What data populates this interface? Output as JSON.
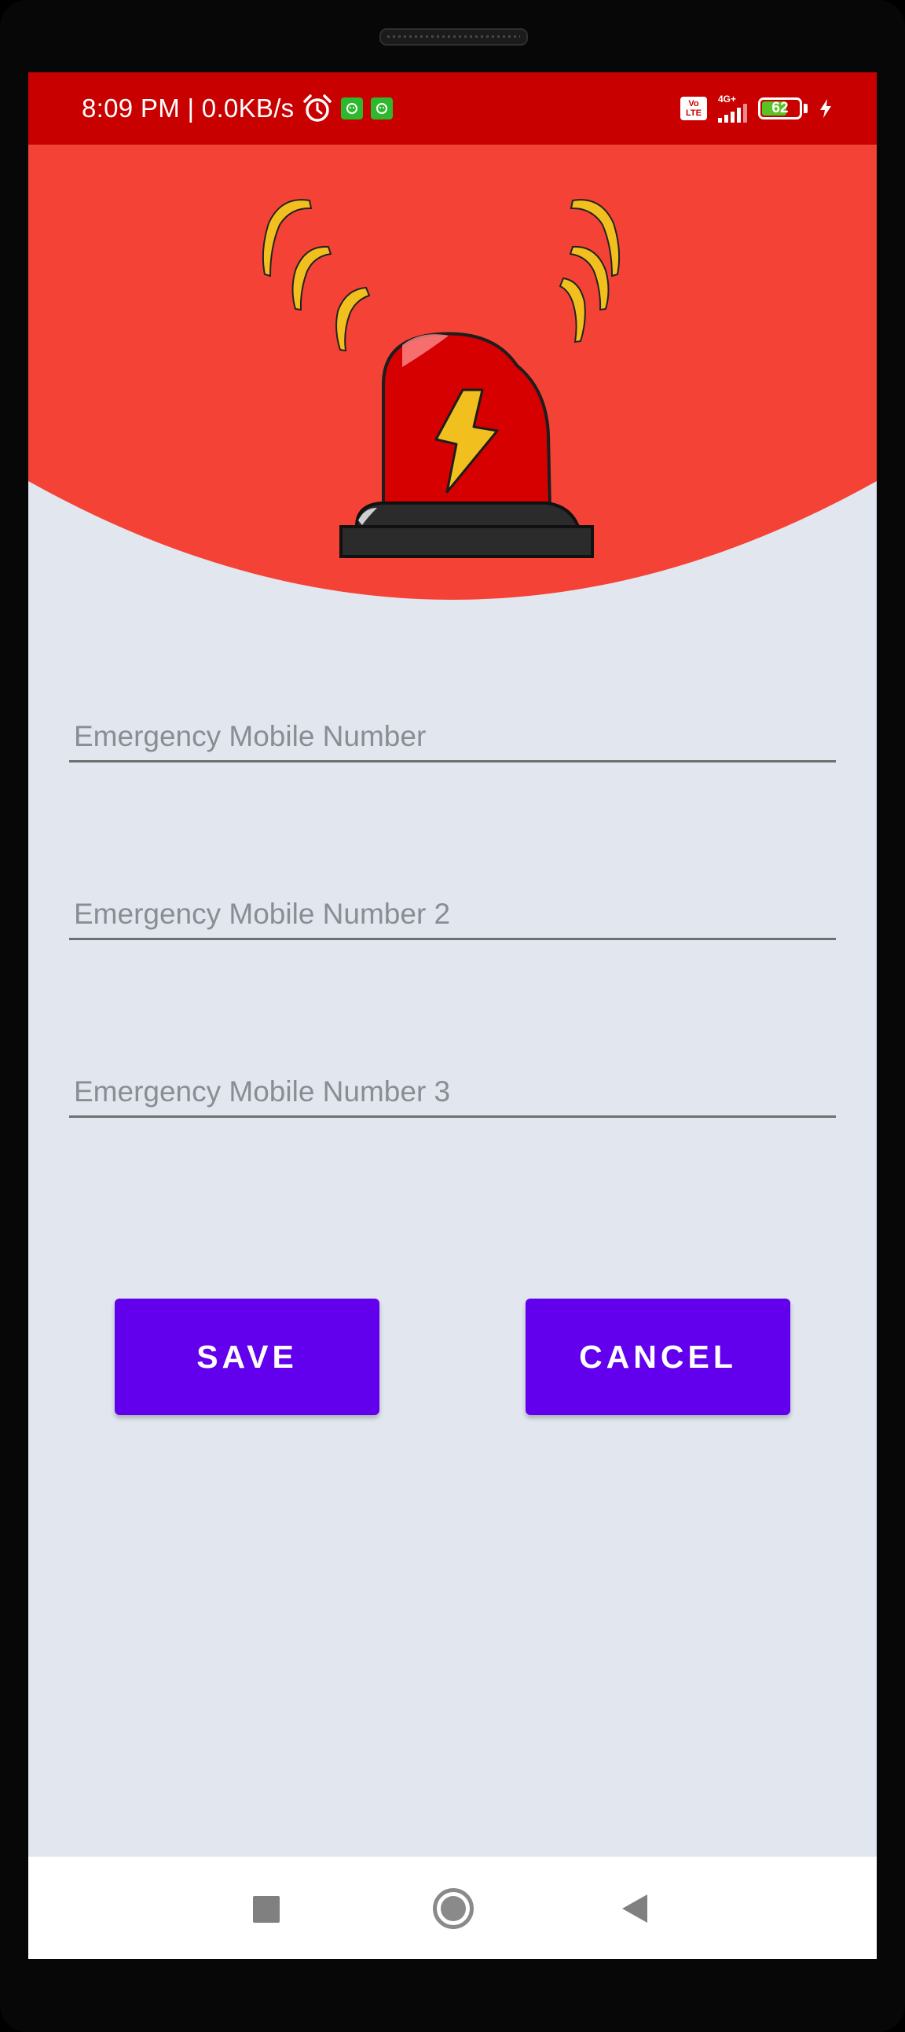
{
  "status_bar": {
    "time": "8:09 PM | 0.0KB/s",
    "volte_top": "Vo",
    "volte_bottom": "LTE",
    "network_type": "4G+",
    "battery_level": "62",
    "icons": [
      "alarm-icon",
      "app-notification-icon",
      "app-notification-icon",
      "volte-icon",
      "signal-icon",
      "battery-icon",
      "charging-icon"
    ]
  },
  "header": {
    "illustration": "siren-alarm",
    "colors": {
      "background": "#f44336",
      "siren_dome": "#d60000",
      "siren_base": "#2b2b2b",
      "waves": "#f2c01e",
      "bolt": "#f2c01e"
    }
  },
  "form": {
    "fields": [
      {
        "placeholder": "Emergency Mobile Number",
        "value": ""
      },
      {
        "placeholder": "Emergency Mobile Number 2",
        "value": ""
      },
      {
        "placeholder": "Emergency Mobile Number 3",
        "value": ""
      }
    ]
  },
  "actions": {
    "save_label": "SAVE",
    "cancel_label": "CANCEL",
    "color": "#6200ee"
  },
  "nav": {
    "icons": [
      "recents-icon",
      "home-icon",
      "back-icon"
    ]
  }
}
